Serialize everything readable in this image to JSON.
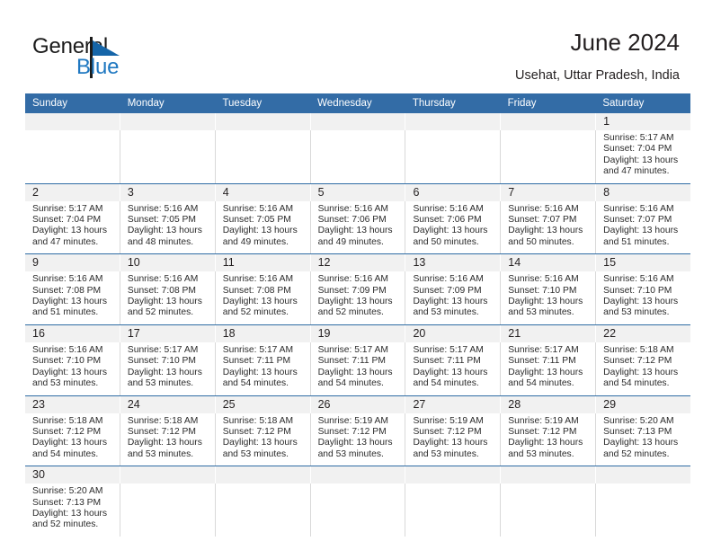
{
  "brand": {
    "name_part1": "General",
    "name_part2": "Blue",
    "logo_icon": "triangle-flag-icon",
    "accent_color": "#1f78c1"
  },
  "header": {
    "title": "June 2024",
    "location": "Usehat, Uttar Pradesh, India"
  },
  "calendar": {
    "header_bg": "#336ca6",
    "row_divider_color": "#2e6ca4",
    "daynum_band_bg": "#f1f1f1",
    "weekday_labels": [
      "Sunday",
      "Monday",
      "Tuesday",
      "Wednesday",
      "Thursday",
      "Friday",
      "Saturday"
    ],
    "weeks": [
      [
        {
          "day": "",
          "lines": []
        },
        {
          "day": "",
          "lines": []
        },
        {
          "day": "",
          "lines": []
        },
        {
          "day": "",
          "lines": []
        },
        {
          "day": "",
          "lines": []
        },
        {
          "day": "",
          "lines": []
        },
        {
          "day": "1",
          "lines": [
            "Sunrise: 5:17 AM",
            "Sunset: 7:04 PM",
            "Daylight: 13 hours",
            "and 47 minutes."
          ]
        }
      ],
      [
        {
          "day": "2",
          "lines": [
            "Sunrise: 5:17 AM",
            "Sunset: 7:04 PM",
            "Daylight: 13 hours",
            "and 47 minutes."
          ]
        },
        {
          "day": "3",
          "lines": [
            "Sunrise: 5:16 AM",
            "Sunset: 7:05 PM",
            "Daylight: 13 hours",
            "and 48 minutes."
          ]
        },
        {
          "day": "4",
          "lines": [
            "Sunrise: 5:16 AM",
            "Sunset: 7:05 PM",
            "Daylight: 13 hours",
            "and 49 minutes."
          ]
        },
        {
          "day": "5",
          "lines": [
            "Sunrise: 5:16 AM",
            "Sunset: 7:06 PM",
            "Daylight: 13 hours",
            "and 49 minutes."
          ]
        },
        {
          "day": "6",
          "lines": [
            "Sunrise: 5:16 AM",
            "Sunset: 7:06 PM",
            "Daylight: 13 hours",
            "and 50 minutes."
          ]
        },
        {
          "day": "7",
          "lines": [
            "Sunrise: 5:16 AM",
            "Sunset: 7:07 PM",
            "Daylight: 13 hours",
            "and 50 minutes."
          ]
        },
        {
          "day": "8",
          "lines": [
            "Sunrise: 5:16 AM",
            "Sunset: 7:07 PM",
            "Daylight: 13 hours",
            "and 51 minutes."
          ]
        }
      ],
      [
        {
          "day": "9",
          "lines": [
            "Sunrise: 5:16 AM",
            "Sunset: 7:08 PM",
            "Daylight: 13 hours",
            "and 51 minutes."
          ]
        },
        {
          "day": "10",
          "lines": [
            "Sunrise: 5:16 AM",
            "Sunset: 7:08 PM",
            "Daylight: 13 hours",
            "and 52 minutes."
          ]
        },
        {
          "day": "11",
          "lines": [
            "Sunrise: 5:16 AM",
            "Sunset: 7:08 PM",
            "Daylight: 13 hours",
            "and 52 minutes."
          ]
        },
        {
          "day": "12",
          "lines": [
            "Sunrise: 5:16 AM",
            "Sunset: 7:09 PM",
            "Daylight: 13 hours",
            "and 52 minutes."
          ]
        },
        {
          "day": "13",
          "lines": [
            "Sunrise: 5:16 AM",
            "Sunset: 7:09 PM",
            "Daylight: 13 hours",
            "and 53 minutes."
          ]
        },
        {
          "day": "14",
          "lines": [
            "Sunrise: 5:16 AM",
            "Sunset: 7:10 PM",
            "Daylight: 13 hours",
            "and 53 minutes."
          ]
        },
        {
          "day": "15",
          "lines": [
            "Sunrise: 5:16 AM",
            "Sunset: 7:10 PM",
            "Daylight: 13 hours",
            "and 53 minutes."
          ]
        }
      ],
      [
        {
          "day": "16",
          "lines": [
            "Sunrise: 5:16 AM",
            "Sunset: 7:10 PM",
            "Daylight: 13 hours",
            "and 53 minutes."
          ]
        },
        {
          "day": "17",
          "lines": [
            "Sunrise: 5:17 AM",
            "Sunset: 7:10 PM",
            "Daylight: 13 hours",
            "and 53 minutes."
          ]
        },
        {
          "day": "18",
          "lines": [
            "Sunrise: 5:17 AM",
            "Sunset: 7:11 PM",
            "Daylight: 13 hours",
            "and 54 minutes."
          ]
        },
        {
          "day": "19",
          "lines": [
            "Sunrise: 5:17 AM",
            "Sunset: 7:11 PM",
            "Daylight: 13 hours",
            "and 54 minutes."
          ]
        },
        {
          "day": "20",
          "lines": [
            "Sunrise: 5:17 AM",
            "Sunset: 7:11 PM",
            "Daylight: 13 hours",
            "and 54 minutes."
          ]
        },
        {
          "day": "21",
          "lines": [
            "Sunrise: 5:17 AM",
            "Sunset: 7:11 PM",
            "Daylight: 13 hours",
            "and 54 minutes."
          ]
        },
        {
          "day": "22",
          "lines": [
            "Sunrise: 5:18 AM",
            "Sunset: 7:12 PM",
            "Daylight: 13 hours",
            "and 54 minutes."
          ]
        }
      ],
      [
        {
          "day": "23",
          "lines": [
            "Sunrise: 5:18 AM",
            "Sunset: 7:12 PM",
            "Daylight: 13 hours",
            "and 54 minutes."
          ]
        },
        {
          "day": "24",
          "lines": [
            "Sunrise: 5:18 AM",
            "Sunset: 7:12 PM",
            "Daylight: 13 hours",
            "and 53 minutes."
          ]
        },
        {
          "day": "25",
          "lines": [
            "Sunrise: 5:18 AM",
            "Sunset: 7:12 PM",
            "Daylight: 13 hours",
            "and 53 minutes."
          ]
        },
        {
          "day": "26",
          "lines": [
            "Sunrise: 5:19 AM",
            "Sunset: 7:12 PM",
            "Daylight: 13 hours",
            "and 53 minutes."
          ]
        },
        {
          "day": "27",
          "lines": [
            "Sunrise: 5:19 AM",
            "Sunset: 7:12 PM",
            "Daylight: 13 hours",
            "and 53 minutes."
          ]
        },
        {
          "day": "28",
          "lines": [
            "Sunrise: 5:19 AM",
            "Sunset: 7:12 PM",
            "Daylight: 13 hours",
            "and 53 minutes."
          ]
        },
        {
          "day": "29",
          "lines": [
            "Sunrise: 5:20 AM",
            "Sunset: 7:13 PM",
            "Daylight: 13 hours",
            "and 52 minutes."
          ]
        }
      ],
      [
        {
          "day": "30",
          "lines": [
            "Sunrise: 5:20 AM",
            "Sunset: 7:13 PM",
            "Daylight: 13 hours",
            "and 52 minutes."
          ]
        },
        {
          "day": "",
          "lines": []
        },
        {
          "day": "",
          "lines": []
        },
        {
          "day": "",
          "lines": []
        },
        {
          "day": "",
          "lines": []
        },
        {
          "day": "",
          "lines": []
        },
        {
          "day": "",
          "lines": []
        }
      ]
    ]
  }
}
